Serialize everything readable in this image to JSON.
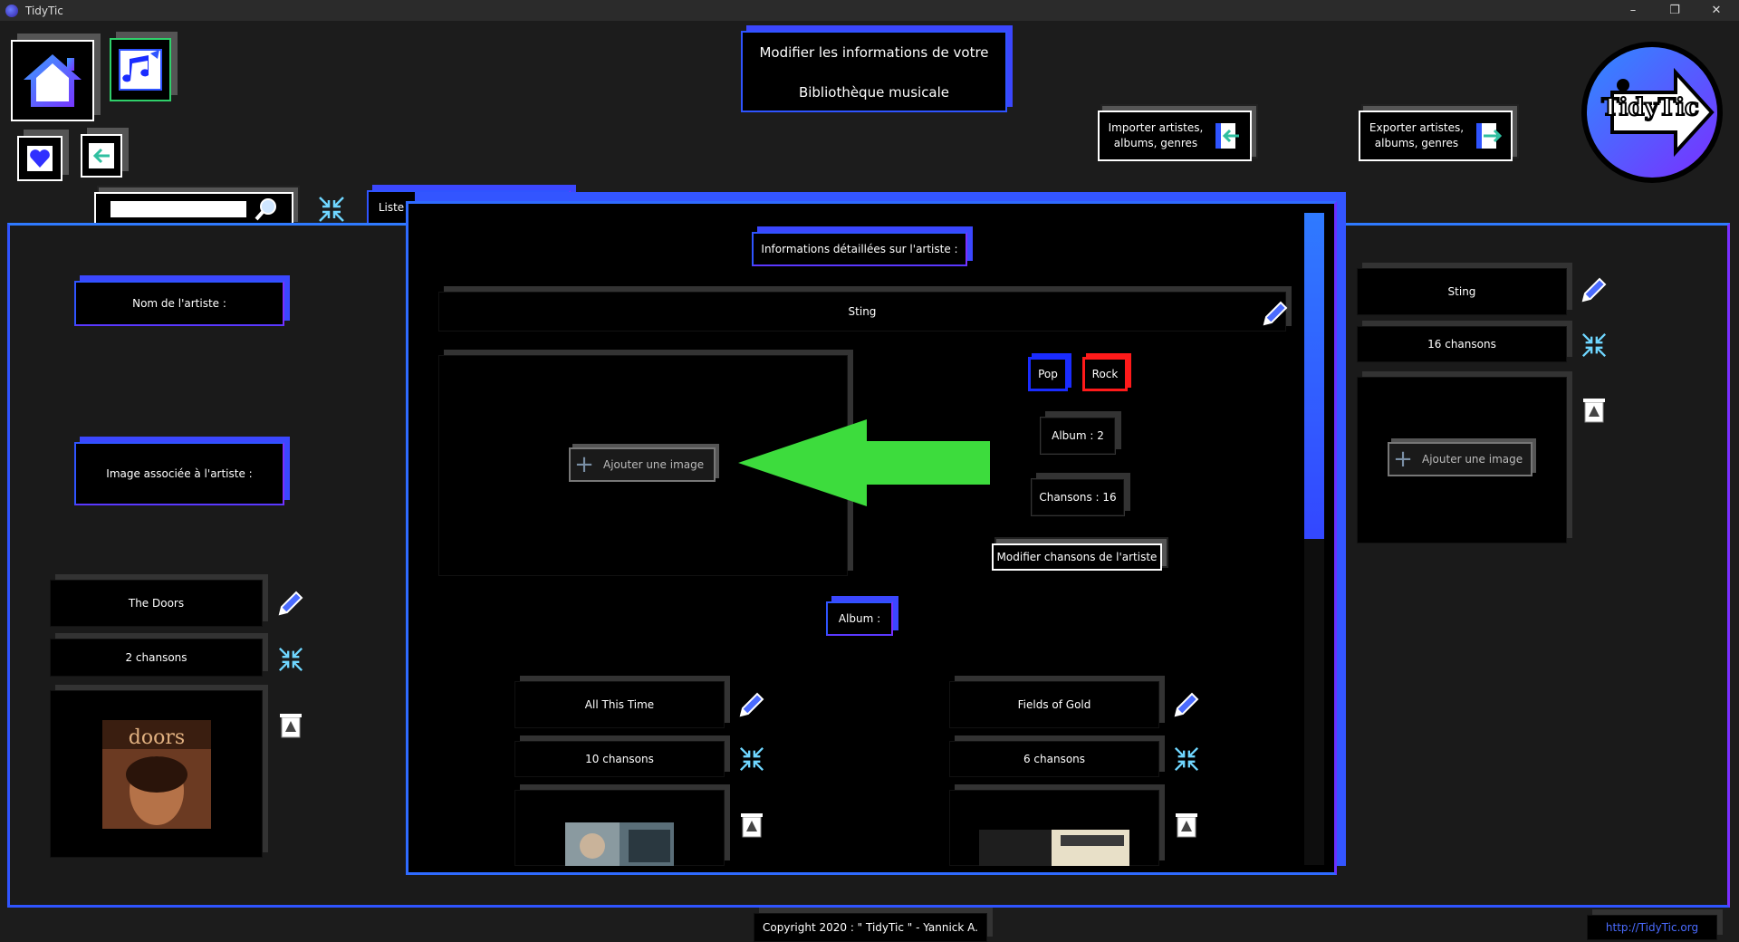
{
  "window": {
    "title": "TidyTic",
    "minimize": "–",
    "restore": "❐",
    "close": "✕"
  },
  "header": {
    "title_line1": "Modifier les informations de votre",
    "title_line2": "Bibliothèque musicale",
    "import_label_1": "Importer artistes,",
    "import_label_2": "albums, genres",
    "export_label_1": "Exporter artistes,",
    "export_label_2": "albums, genres",
    "logo_text": "TidyTic"
  },
  "search": {
    "placeholder": "",
    "value": ""
  },
  "tab": {
    "label": "Liste"
  },
  "left_panel": {
    "artist_name_label": "Nom de l'artiste :",
    "artist_image_label": "Image associée à l'artiste :",
    "card": {
      "name": "The Doors",
      "songs": "2 chansons"
    }
  },
  "detail": {
    "heading": "Informations détaillées sur l'artiste :",
    "artist_name": "Sting",
    "add_image": "Ajouter une image",
    "genres": [
      {
        "name": "Pop",
        "color": "#1a2cff"
      },
      {
        "name": "Rock",
        "color": "#ff1a1a"
      }
    ],
    "albums_count": "Album  : 2",
    "songs_count": "Chansons  : 16",
    "edit_songs": "Modifier chansons de l'artiste",
    "album_heading": "Album  :",
    "albums": [
      {
        "name": "All This Time",
        "songs": "10 chansons"
      },
      {
        "name": "Fields of Gold",
        "songs": "6 chansons"
      }
    ]
  },
  "right_panel": {
    "name": "Sting",
    "songs": "16 chansons",
    "add_image": "Ajouter une image"
  },
  "footer": {
    "copyright": "Copyright 2020 : \" TidyTic \" - Yannick A.",
    "url": "http://TidyTic.org"
  },
  "colors": {
    "accent_blue": "#2f54ff",
    "accent_purple": "#7a2fff",
    "arrow_green": "#3ddc3d"
  }
}
